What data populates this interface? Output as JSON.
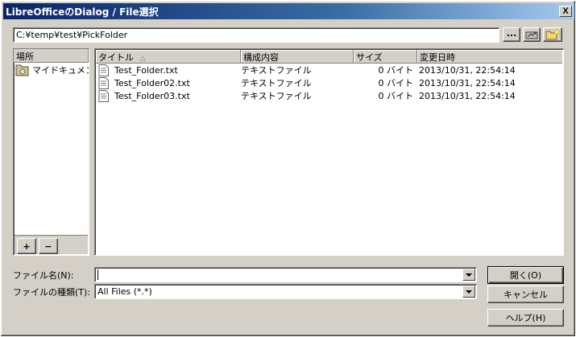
{
  "window": {
    "title": "LibreOfficeのDialog / File選択",
    "close_label": "X"
  },
  "path": {
    "value": "C:¥temp¥test¥PickFolder",
    "browse_label": "..."
  },
  "places": {
    "header": "場所",
    "items": [
      {
        "label": "マイドキュメント",
        "icon": "my-documents-icon"
      }
    ],
    "add_label": "+",
    "remove_label": "−"
  },
  "filelist": {
    "columns": {
      "title": "タイトル",
      "sort_indicator": "△",
      "type": "構成内容",
      "size": "サイズ",
      "modified": "変更日時"
    },
    "rows": [
      {
        "name": "Test_Folder.txt",
        "type": "テキストファイル",
        "size": "0 バイト",
        "modified": "2013/10/31, 22:54:14"
      },
      {
        "name": "Test_Folder02.txt",
        "type": "テキストファイル",
        "size": "0 バイト",
        "modified": "2013/10/31, 22:54:14"
      },
      {
        "name": "Test_Folder03.txt",
        "type": "テキストファイル",
        "size": "0 バイト",
        "modified": "2013/10/31, 22:54:14"
      }
    ]
  },
  "filename": {
    "label": "ファイル名(N):",
    "value": ""
  },
  "filetype": {
    "label": "ファイルの種類(T):",
    "value": "All Files (*.*)"
  },
  "buttons": {
    "open": "開く(O)",
    "cancel": "キャンセル",
    "help": "ヘルプ(H)"
  }
}
